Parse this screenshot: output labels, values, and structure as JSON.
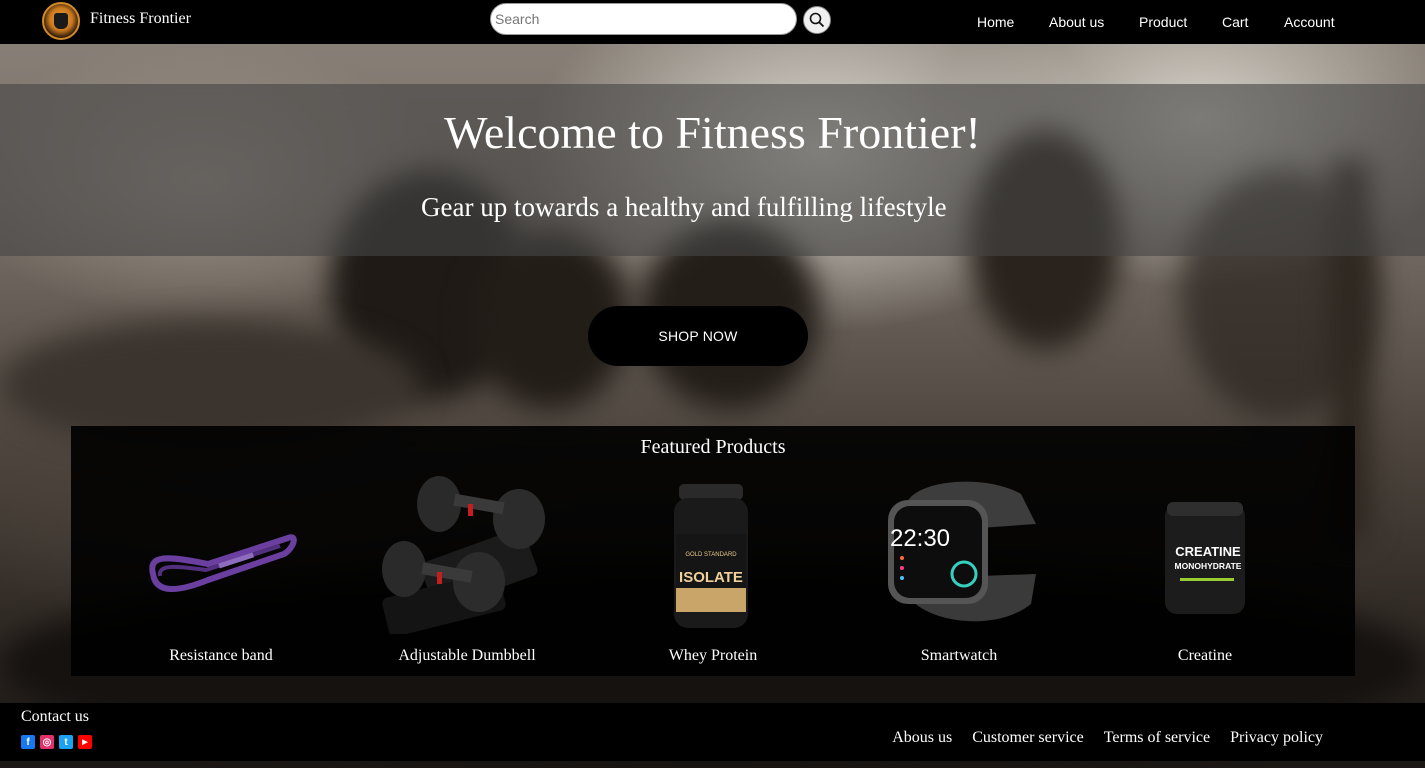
{
  "brand": {
    "name": "Fitness Frontier",
    "logo_icon": "fitness-frontier-logo"
  },
  "search": {
    "placeholder": "Search",
    "value": "",
    "button_icon": "search-icon"
  },
  "nav": {
    "items": [
      {
        "label": "Home"
      },
      {
        "label": "About us"
      },
      {
        "label": "Product"
      },
      {
        "label": "Cart"
      },
      {
        "label": "Account"
      }
    ]
  },
  "hero": {
    "title": "Welcome to Fitness Frontier!",
    "subtitle": "Gear up towards a healthy and fulfilling lifestyle",
    "cta_label": "SHOP NOW"
  },
  "featured": {
    "title": "Featured Products",
    "products": [
      {
        "name": "Resistance band",
        "icon": "resistance-band-image"
      },
      {
        "name": "Adjustable Dumbbell",
        "icon": "adjustable-dumbbell-image"
      },
      {
        "name": "Whey Protein",
        "icon": "whey-protein-image",
        "label_top": "GOLD STANDARD",
        "label_main": "ISOLATE"
      },
      {
        "name": "Smartwatch",
        "icon": "smartwatch-image",
        "time": "22:30"
      },
      {
        "name": "Creatine",
        "icon": "creatine-image",
        "label_main": "CREATINE",
        "label_sub": "MONOHYDRATE"
      }
    ]
  },
  "footer": {
    "contact_title": "Contact us",
    "socials": [
      {
        "name": "facebook-icon",
        "glyph": "f",
        "color": "#1877f2"
      },
      {
        "name": "instagram-icon",
        "glyph": "◎",
        "color": "#e1306c"
      },
      {
        "name": "twitter-icon",
        "glyph": "t",
        "color": "#1da1f2"
      },
      {
        "name": "youtube-icon",
        "glyph": "▶",
        "color": "#ff0000"
      }
    ],
    "links": [
      {
        "label": "Abous us"
      },
      {
        "label": "Customer service"
      },
      {
        "label": "Terms of service"
      },
      {
        "label": "Privacy policy"
      }
    ]
  },
  "colors": {
    "nav_bg": "#000000",
    "hero_band": "#464646",
    "button_bg": "#000000",
    "text": "#ffffff"
  }
}
